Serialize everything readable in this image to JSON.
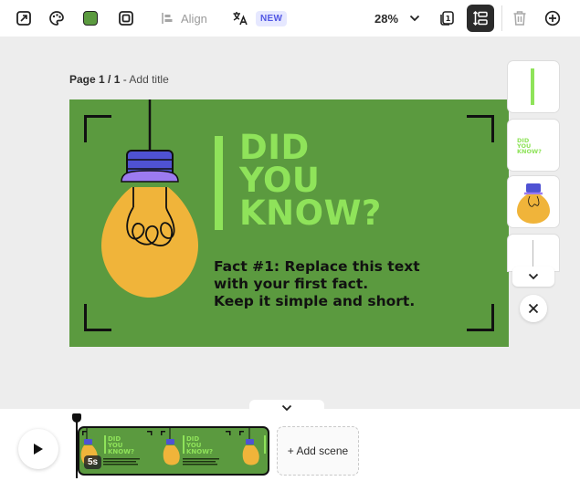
{
  "toolbar": {
    "align_label": "Align",
    "new_badge": "NEW",
    "zoom": "28%",
    "page_count_icon": "1",
    "brand_color": "#5b9a3f"
  },
  "page": {
    "number": "Page 1 / 1",
    "separator": " - ",
    "add_title": "Add title"
  },
  "slide": {
    "background": "#5b9a3f",
    "accent": "#8fe35a",
    "headline": [
      "DID",
      "YOU",
      "KNOW?"
    ],
    "fact_lines": [
      "Fact #1: Replace this text",
      "with your first fact.",
      "Keep it simple and short."
    ]
  },
  "side_panel": {
    "thumb_text": [
      "DID",
      "YOU",
      "KNOW?"
    ]
  },
  "timeline": {
    "scene_duration": "5s",
    "add_scene_label": "+ Add scene"
  }
}
